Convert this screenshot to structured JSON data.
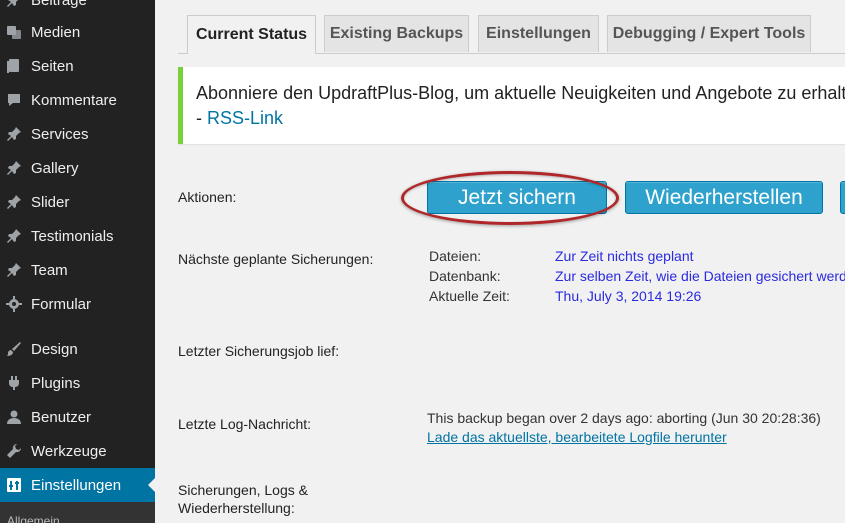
{
  "sidebar": {
    "items": [
      {
        "label": "Beiträge",
        "icon": "pin-icon"
      },
      {
        "label": "Medien",
        "icon": "media-icon"
      },
      {
        "label": "Seiten",
        "icon": "pages-icon"
      },
      {
        "label": "Kommentare",
        "icon": "comments-icon"
      },
      {
        "label": "Services",
        "icon": "pin-icon"
      },
      {
        "label": "Gallery",
        "icon": "pin-icon"
      },
      {
        "label": "Slider",
        "icon": "pin-icon"
      },
      {
        "label": "Testimonials",
        "icon": "pin-icon"
      },
      {
        "label": "Team",
        "icon": "pin-icon"
      },
      {
        "label": "Formular",
        "icon": "gear-icon"
      },
      {
        "label": "Design",
        "icon": "brush-icon"
      },
      {
        "label": "Plugins",
        "icon": "plug-icon"
      },
      {
        "label": "Benutzer",
        "icon": "user-icon"
      },
      {
        "label": "Werkzeuge",
        "icon": "wrench-icon"
      },
      {
        "label": "Einstellungen",
        "icon": "settings-icon",
        "active": true
      }
    ],
    "submenu_first": "Allgemein"
  },
  "tabs": [
    {
      "label": "Current Status",
      "active": true
    },
    {
      "label": "Existing Backups"
    },
    {
      "label": "Einstellungen"
    },
    {
      "label": "Debugging / Expert Tools"
    }
  ],
  "notice": {
    "text": "Abonniere den UpdraftPlus-Blog, um aktuelle Neuigkeiten und Angebote zu erhalten",
    "link_prefix": "- ",
    "link_label": "RSS-Link"
  },
  "actions": {
    "label": "Aktionen:",
    "backup_button": "Jetzt sichern",
    "restore_button": "Wiederherstellen"
  },
  "schedule": {
    "label": "Nächste geplante Sicherungen:",
    "rows": [
      {
        "key": "Dateien:",
        "value": "Zur Zeit nichts geplant"
      },
      {
        "key": "Datenbank:",
        "value": "Zur selben Zeit, wie die Dateien gesichert werden"
      },
      {
        "key": "Aktuelle Zeit:",
        "value": "Thu, July 3, 2014 19:26"
      }
    ]
  },
  "last_job": {
    "label": "Letzter Sicherungsjob lief:"
  },
  "last_log": {
    "label": "Letzte Log-Nachricht:",
    "message": "This backup began over 2 days ago: aborting (Jun 30 20:28:36)",
    "link": "Lade das aktuellste, bearbeitete Logfile herunter"
  },
  "backups_section": {
    "label_line1": "Sicherungen, Logs &",
    "label_line2": "Wiederherstellung:"
  },
  "colors": {
    "sidebar_bg": "#222222",
    "active_menu": "#0074a2",
    "button": "#2ea2cc",
    "notice_border": "#7ad03a",
    "highlight_ring": "#b0272a"
  }
}
